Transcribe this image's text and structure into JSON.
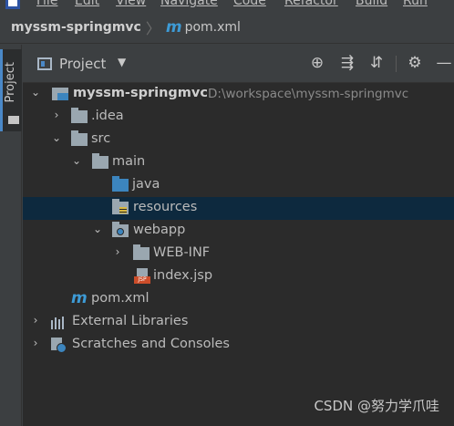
{
  "menu": {
    "items": [
      "File",
      "Edit",
      "View",
      "Navigate",
      "Code",
      "Refactor",
      "Build",
      "Run"
    ]
  },
  "breadcrumb": {
    "project": "myssm-springmvc",
    "separator": "〉",
    "file_icon": "m",
    "file": "pom.xml"
  },
  "tool_window_tab": {
    "label": "Project"
  },
  "panel": {
    "title": "Project",
    "view_dropdown_glyph": "▼",
    "toolbar": {
      "locate_glyph": "⊕",
      "expand_glyph": "⇶",
      "collapse_glyph": "⇵",
      "settings_glyph": "⚙",
      "hide_glyph": "—"
    }
  },
  "tree": {
    "root": {
      "name": "myssm-springmvc",
      "path": "D:\\workspace\\myssm-springmvc",
      "arrow": "⌄"
    },
    "idea": {
      "name": ".idea",
      "arrow": "›"
    },
    "src": {
      "name": "src",
      "arrow": "⌄"
    },
    "main": {
      "name": "main",
      "arrow": "⌄"
    },
    "java": {
      "name": "java"
    },
    "resources": {
      "name": "resources"
    },
    "webapp": {
      "name": "webapp",
      "arrow": "⌄"
    },
    "webinf": {
      "name": "WEB-INF",
      "arrow": "›"
    },
    "indexjsp": {
      "name": "index.jsp",
      "badge": "JSP"
    },
    "pom": {
      "name": "pom.xml",
      "icon": "m"
    },
    "external_libraries": {
      "name": "External Libraries",
      "arrow": "›"
    },
    "scratches": {
      "name": "Scratches and Consoles",
      "arrow": "›"
    }
  },
  "watermark": "CSDN @努力学爪哇",
  "colors": {
    "panel_bg": "#3c3f41",
    "tree_bg": "#2b2b2b",
    "selection": "#0d293e",
    "accent_blue": "#3d9bd6",
    "jsp_badge": "#cc4d2a"
  },
  "icons": {
    "project_view": "project-icon",
    "folder": "folder-icon",
    "source_folder": "source-folder-icon",
    "resource_folder": "resource-folder-icon",
    "web_folder": "web-folder-icon",
    "module": "module-icon",
    "maven": "maven-icon",
    "jsp": "jsp-file-icon",
    "libraries": "libraries-icon",
    "scratches": "scratches-icon"
  }
}
